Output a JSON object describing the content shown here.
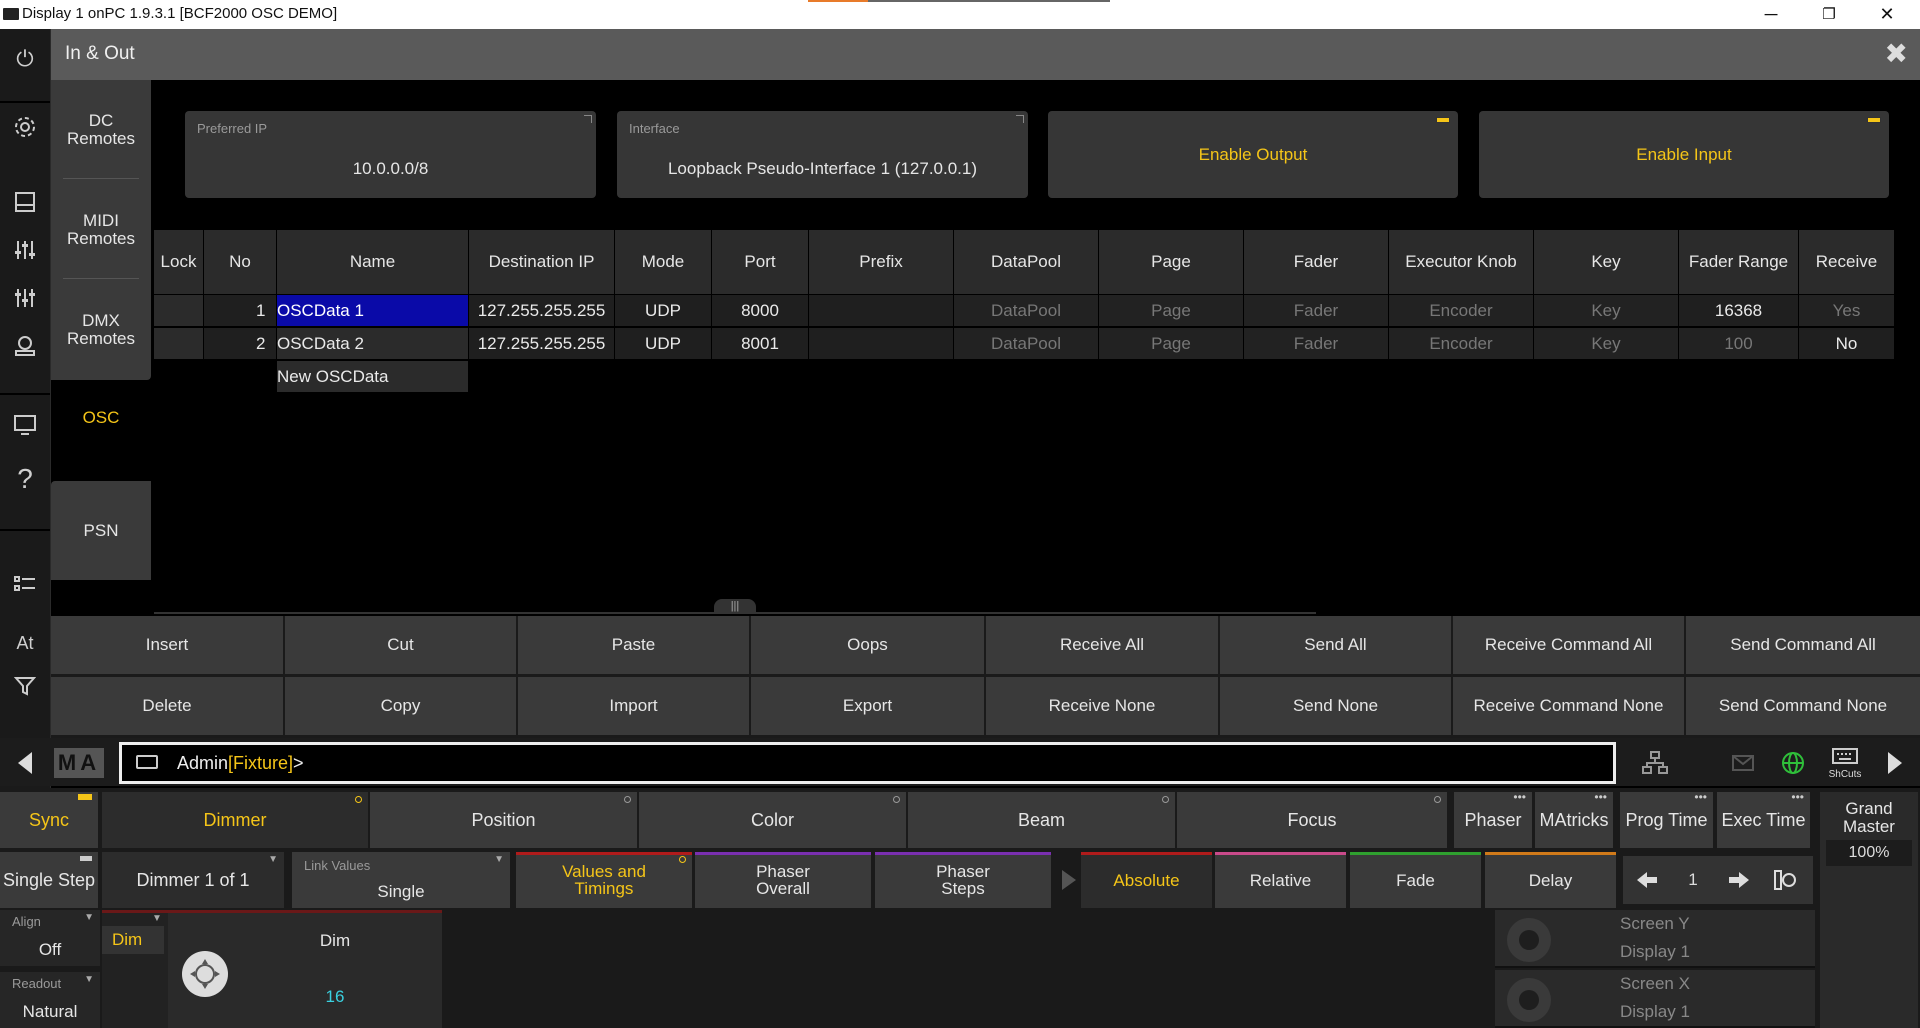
{
  "window": {
    "title": "Display 1 onPC 1.9.3.1 [BCF2000 OSC DEMO]",
    "minimize": "─",
    "restore": "❐",
    "close": "✕"
  },
  "sidebar": {
    "power": "⏻",
    "icons": [
      "gear-icon",
      "layout-icon",
      "sliders-icon",
      "faders-icon",
      "group-icon",
      "monitor-icon",
      "help-icon",
      "list-icon"
    ],
    "at_label": "At",
    "filter": "⛛"
  },
  "header": {
    "title": "In & Out",
    "close": "✖"
  },
  "leftnav": {
    "items": [
      {
        "label": "DC\nRemotes"
      },
      {
        "label": "MIDI\nRemotes"
      },
      {
        "label": "DMX\nRemotes"
      },
      {
        "label": "OSC"
      },
      {
        "label": "PSN"
      }
    ]
  },
  "settings": {
    "preferred_ip_label": "Preferred IP",
    "preferred_ip_value": "10.0.0.0/8",
    "interface_label": "Interface",
    "interface_value": "Loopback Pseudo-Interface 1 (127.0.0.1)",
    "enable_output": "Enable Output",
    "enable_input": "Enable Input"
  },
  "table": {
    "headers": [
      "Lock",
      "No",
      "Name",
      "Destination IP",
      "Mode",
      "Port",
      "Prefix",
      "DataPool",
      "Page",
      "Fader",
      "Executor Knob",
      "Key",
      "Fader Range",
      "Receive"
    ],
    "rows": [
      {
        "lock": "",
        "no": "1",
        "name": "OSCData 1",
        "ip": "127.255.255.255",
        "mode": "UDP",
        "port": "8000",
        "prefix": "",
        "datapool": "DataPool",
        "page": "Page",
        "fader": "Fader",
        "knob": "Encoder",
        "key": "Key",
        "range": "16368",
        "receive": "Yes"
      },
      {
        "lock": "",
        "no": "2",
        "name": "OSCData 2",
        "ip": "127.255.255.255",
        "mode": "UDP",
        "port": "8001",
        "prefix": "",
        "datapool": "DataPool",
        "page": "Page",
        "fader": "Fader",
        "knob": "Encoder",
        "key": "Key",
        "range": "100",
        "receive": "No"
      }
    ],
    "new_row": "New OSCData"
  },
  "actions": {
    "row1": [
      "Insert",
      "Cut",
      "Paste",
      "Oops",
      "Receive All",
      "Send All",
      "Receive Command All",
      "Send Command All"
    ],
    "row2": [
      "Delete",
      "Copy",
      "Import",
      "Export",
      "Receive None",
      "Send None",
      "Receive Command None",
      "Send Command None"
    ]
  },
  "command": {
    "logo": "MA",
    "user": "Admin",
    "location": "[Fixture]",
    "prompt": ">",
    "shortcuts": "ShCuts"
  },
  "features": {
    "sync": "Sync",
    "tabs": [
      "Dimmer",
      "Position",
      "Color",
      "Beam",
      "Focus"
    ],
    "right_tabs": [
      "Phaser",
      "MAtricks",
      "Prog Time",
      "Exec Time"
    ],
    "grand_master_label": "Grand Master",
    "grand_master_value": "100%"
  },
  "controls": {
    "single_step": "Single Step",
    "dimmer_count": "Dimmer 1 of 1",
    "link_values_label": "Link Values",
    "link_values_value": "Single",
    "values_timings": "Values and Timings",
    "phaser_overall": "Phaser Overall",
    "phaser_steps": "Phaser Steps",
    "absolute": "Absolute",
    "relative": "Relative",
    "fade": "Fade",
    "delay": "Delay",
    "page_num": "1"
  },
  "bottom": {
    "align_label": "Align",
    "align_value": "Off",
    "readout_label": "Readout",
    "readout_value": "Natural",
    "dim_tab": "Dim",
    "dim_title": "Dim",
    "dim_value": "16",
    "screen_y": "Screen Y",
    "screen_y_display": "Display 1",
    "screen_x": "Screen X",
    "screen_x_display": "Display 1"
  },
  "colors": {
    "accent_yellow": "#f5c518",
    "selection_blue": "#0a0aa8",
    "dim_cyan": "#3ad1e0"
  }
}
